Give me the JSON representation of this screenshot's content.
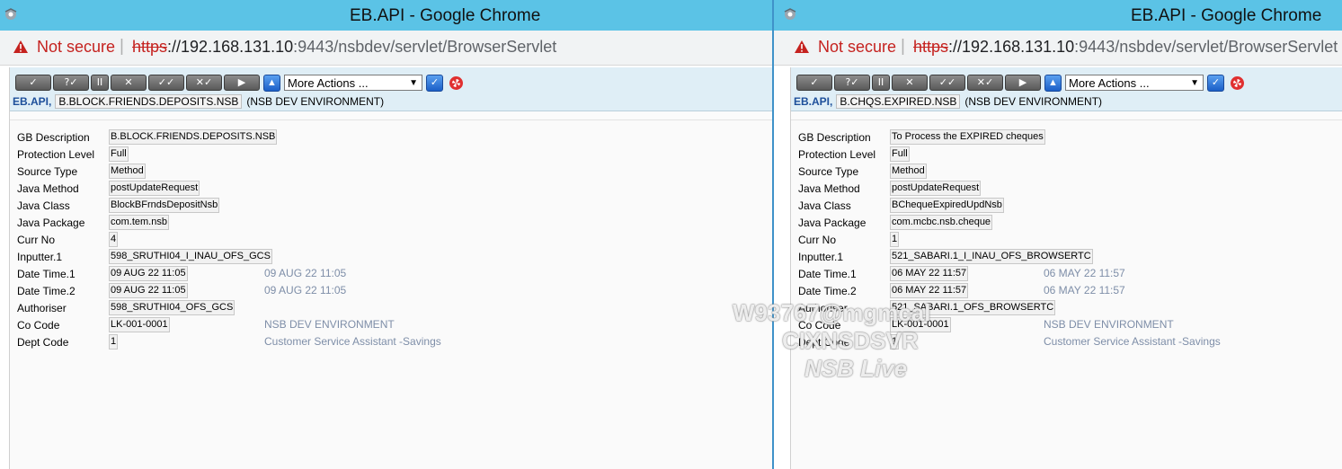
{
  "windows": [
    {
      "title": "EB.API - Google Chrome",
      "not_secure": "Not secure",
      "url_scheme": "https",
      "url_host": "://192.168.131.10",
      "url_rest": ":9443/nsbdev/servlet/BrowserServlet",
      "more_actions": "More Actions ...",
      "app": "EB.API,",
      "record_id": "B.BLOCK.FRIENDS.DEPOSITS.NSB",
      "environment": "(NSB DEV ENVIRONMENT)",
      "fields": [
        {
          "label": "GB Description",
          "value": "B.BLOCK.FRIENDS.DEPOSITS.NSB",
          "extra": ""
        },
        {
          "label": "Protection Level",
          "value": "Full",
          "extra": ""
        },
        {
          "label": "Source Type",
          "value": "Method",
          "extra": ""
        },
        {
          "label": "Java Method",
          "value": "postUpdateRequest",
          "extra": ""
        },
        {
          "label": "Java Class",
          "value": "BlockBFrndsDepositNsb",
          "extra": ""
        },
        {
          "label": "Java Package",
          "value": "com.tem.nsb",
          "extra": ""
        },
        {
          "label": "Curr No",
          "value": "4",
          "extra": ""
        },
        {
          "label": "Inputter.1",
          "value": "598_SRUTHI04_I_INAU_OFS_GCS",
          "extra": ""
        },
        {
          "label": "Date Time.1",
          "value": "09 AUG 22 11:05",
          "extra": "09 AUG 22 11:05"
        },
        {
          "label": "Date Time.2",
          "value": "09 AUG 22 11:05",
          "extra": "09 AUG 22 11:05"
        },
        {
          "label": "Authoriser",
          "value": "598_SRUTHI04_OFS_GCS",
          "extra": ""
        },
        {
          "label": "Co Code",
          "value": "LK-001-0001",
          "extra": "NSB DEV ENVIRONMENT"
        },
        {
          "label": "Dept Code",
          "value": "1",
          "extra": "Customer Service Assistant -Savings"
        }
      ]
    },
    {
      "title": "EB.API - Google Chrome",
      "not_secure": "Not secure",
      "url_scheme": "https",
      "url_host": "://192.168.131.10",
      "url_rest": ":9443/nsbdev/servlet/BrowserServlet",
      "more_actions": "More Actions ...",
      "app": "EB.API,",
      "record_id": "B.CHQS.EXPIRED.NSB",
      "environment": "(NSB DEV ENVIRONMENT)",
      "fields": [
        {
          "label": "GB Description",
          "value": "To Process the EXPIRED cheques",
          "extra": ""
        },
        {
          "label": "Protection Level",
          "value": "Full",
          "extra": ""
        },
        {
          "label": "Source Type",
          "value": "Method",
          "extra": ""
        },
        {
          "label": "Java Method",
          "value": "postUpdateRequest",
          "extra": ""
        },
        {
          "label": "Java Class",
          "value": "BChequeExpiredUpdNsb",
          "extra": ""
        },
        {
          "label": "Java Package",
          "value": "com.mcbc.nsb.cheque",
          "extra": ""
        },
        {
          "label": "Curr No",
          "value": "1",
          "extra": ""
        },
        {
          "label": "Inputter.1",
          "value": "521_SABARI.1_I_INAU_OFS_BROWSERTC",
          "extra": ""
        },
        {
          "label": "Date Time.1",
          "value": "06 MAY 22 11:57",
          "extra": "06 MAY 22 11:57"
        },
        {
          "label": "Date Time.2",
          "value": "06 MAY 22 11:57",
          "extra": "06 MAY 22 11:57"
        },
        {
          "label": "Authoriser",
          "value": "521_SABARI.1_OFS_BROWSERTC",
          "extra": ""
        },
        {
          "label": "Co Code",
          "value": "LK-001-0001",
          "extra": "NSB DEV ENVIRONMENT"
        },
        {
          "label": "Dept Code",
          "value": "1",
          "extra": "Customer Service Assistant -Savings"
        }
      ]
    }
  ],
  "watermark": {
    "line1": "W93767@mgmcal",
    "line2": "CIXNSDSVR",
    "line3": "NSB Live"
  }
}
